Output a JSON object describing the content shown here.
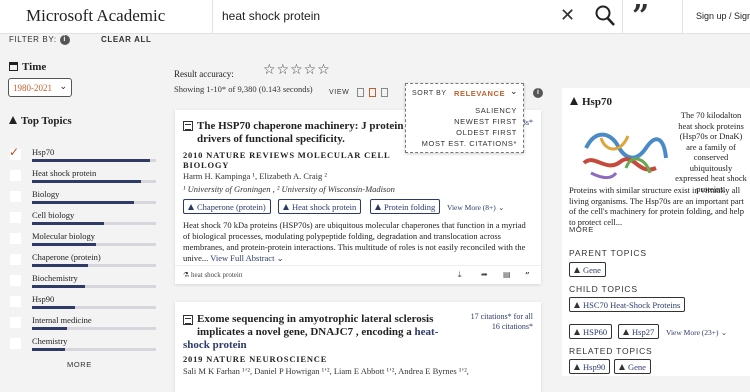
{
  "header": {
    "logo": "Microsoft Academic",
    "search_value": "heat shock protein",
    "sign_in": "Sign up / Sign in"
  },
  "filters": {
    "filter_by": "FILTER BY:",
    "clear_all": "CLEAR ALL",
    "time_heading": "Time",
    "year_range": "1980-2021",
    "topics_heading": "Top Topics",
    "topics": [
      {
        "label": "Hsp70",
        "checked": true,
        "level": 0.95
      },
      {
        "label": "Heat shock protein",
        "checked": false,
        "level": 0.88
      },
      {
        "label": "Biology",
        "checked": false,
        "level": 0.82
      },
      {
        "label": "Cell biology",
        "checked": false,
        "level": 0.58
      },
      {
        "label": "Molecular biology",
        "checked": false,
        "level": 0.52
      },
      {
        "label": "Chaperone (protein)",
        "checked": false,
        "level": 0.45
      },
      {
        "label": "Biochemistry",
        "checked": false,
        "level": 0.43
      },
      {
        "label": "Hsp90",
        "checked": false,
        "level": 0.35
      },
      {
        "label": "Internal medicine",
        "checked": false,
        "level": 0.28
      },
      {
        "label": "Chemistry",
        "checked": false,
        "level": 0.27
      }
    ],
    "more": "MORE"
  },
  "results": {
    "accuracy_label": "Result accuracy:",
    "stars": "☆☆☆☆☆",
    "showing": "Showing 1-10* of 9,380 (0.143 seconds)",
    "view_label": "VIEW",
    "sort_label": "SORT BY",
    "sort_selected": "RELEVANCE",
    "sort_options": [
      "SALIENCY",
      "NEWEST FIRST",
      "OLDEST FIRST",
      "MOST EST. CITATIONS*"
    ]
  },
  "papers": [
    {
      "title_plain": "The HSP70 chaperone machinery: J protein",
      "title_rest": "drivers of functional specificity.",
      "citations": "3s*",
      "year_venue_1": "2010 NATURE REVIEWS MOLECULAR CELL",
      "year_venue_2": "BIOLOGY",
      "authors": "Harm H. Kampinga ¹,   Elizabeth A. Craig ²",
      "affils": "¹  University of Groningen ,   ²  University of Wisconsin-Madison",
      "chips": [
        "Chaperone (protein)",
        "Heat shock protein",
        "Protein folding"
      ],
      "view_more": "View More (8+)",
      "abstract": "Heat shock 70 kDa proteins (HSP70s) are ubiquitous molecular chaperones that function in a myriad of biological processes, modulating polypeptide folding, degradation and translocation across membranes, and protein-protein interactions. This multitude of roles is not easily reconciled with the unive...",
      "abstract_link": "View Full Abstract",
      "footer_source": "heat shock protein"
    },
    {
      "title_line1": "Exome sequencing in amyotrophic lateral sclerosis",
      "title_line2_plain": "implicates a novel gene, DNAJC7 , encoding a ",
      "title_line2_hl": "heat-",
      "title_line3_hl": "shock protein",
      "citations_1": "17 citations* for all",
      "citations_2": "16 citations*",
      "year_venue": "2019 NATURE NEUROSCIENCE",
      "authors": "Sali M K Farhan ¹ʼ²,   Daniel P Howrigan ¹ʼ²,   Liam E Abbott ¹ʼ²,   Andrea E Byrnes ¹ʼ²,"
    }
  ],
  "entity": {
    "title": "Hsp70",
    "desc_side": "The 70 kilodalton heat shock proteins (Hsp70s or DnaK) are a family of conserved ubiquitously expressed heat shock proteins.",
    "desc_body": "Proteins with similar structure exist in virtually all living organisms. The Hsp70s are an important part of the cell's machinery for protein folding, and help to protect cell...",
    "more": "MORE",
    "parent_heading": "PARENT TOPICS",
    "parent_topics": [
      "Gene"
    ],
    "child_heading": "CHILD TOPICS",
    "child_topics": [
      "HSC70 Heat-Shock Proteins",
      "HSP60",
      "Hsp27"
    ],
    "child_view_more": "View More (23+)",
    "related_heading": "RELATED TOPICS",
    "related_topics": [
      "Hsp90",
      "Gene"
    ]
  }
}
